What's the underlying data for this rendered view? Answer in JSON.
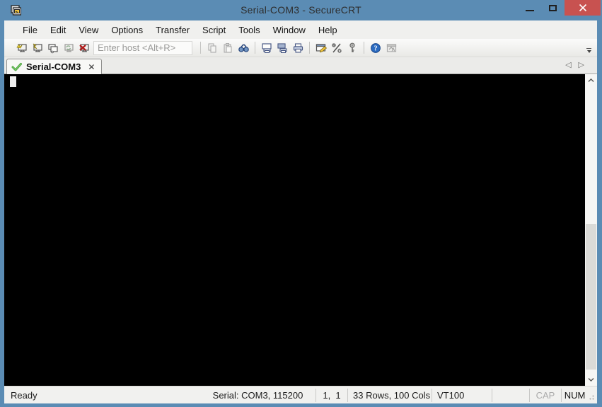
{
  "window": {
    "title": "Serial-COM3 - SecureCRT",
    "controls": {
      "minimize": "minimize",
      "maximize": "maximize",
      "close": "close"
    },
    "colors": {
      "titlebar": "#5b8cb4",
      "close_button": "#c85250",
      "terminal_bg": "#000000",
      "tab_check_green": "#4aa43c"
    }
  },
  "menu_bar": {
    "items": [
      "File",
      "Edit",
      "View",
      "Options",
      "Transfer",
      "Script",
      "Tools",
      "Window",
      "Help"
    ]
  },
  "toolbar": {
    "host_placeholder": "Enter host <Alt+R>",
    "icons": [
      "connect-icon",
      "quick-connect-icon",
      "connect-in-tab-icon",
      "reconnect-icon",
      "disconnect-icon",
      "copy-icon",
      "paste-icon",
      "find-icon",
      "print-screen-icon",
      "print-selection-icon",
      "print-icon",
      "session-options-icon",
      "global-options-icon",
      "key-agent-icon",
      "help-icon",
      "securefx-icon",
      "toolbar-overflow-icon"
    ]
  },
  "tab_bar": {
    "tabs": [
      {
        "label": "Serial-COM3",
        "status": "connected",
        "close_glyph": "✕"
      }
    ],
    "scroll_left_glyph": "◁",
    "scroll_right_glyph": "▷"
  },
  "terminal": {
    "cursor_style": "block",
    "rows": 33,
    "cols": 100
  },
  "status_bar": {
    "ready": "Ready",
    "connection": "Serial: COM3, 115200",
    "cursor_position": "1,  1",
    "terminal_size": "33 Rows, 100 Cols",
    "emulation": "VT100",
    "caps_indicator": "CAP",
    "num_indicator": "NUM"
  }
}
